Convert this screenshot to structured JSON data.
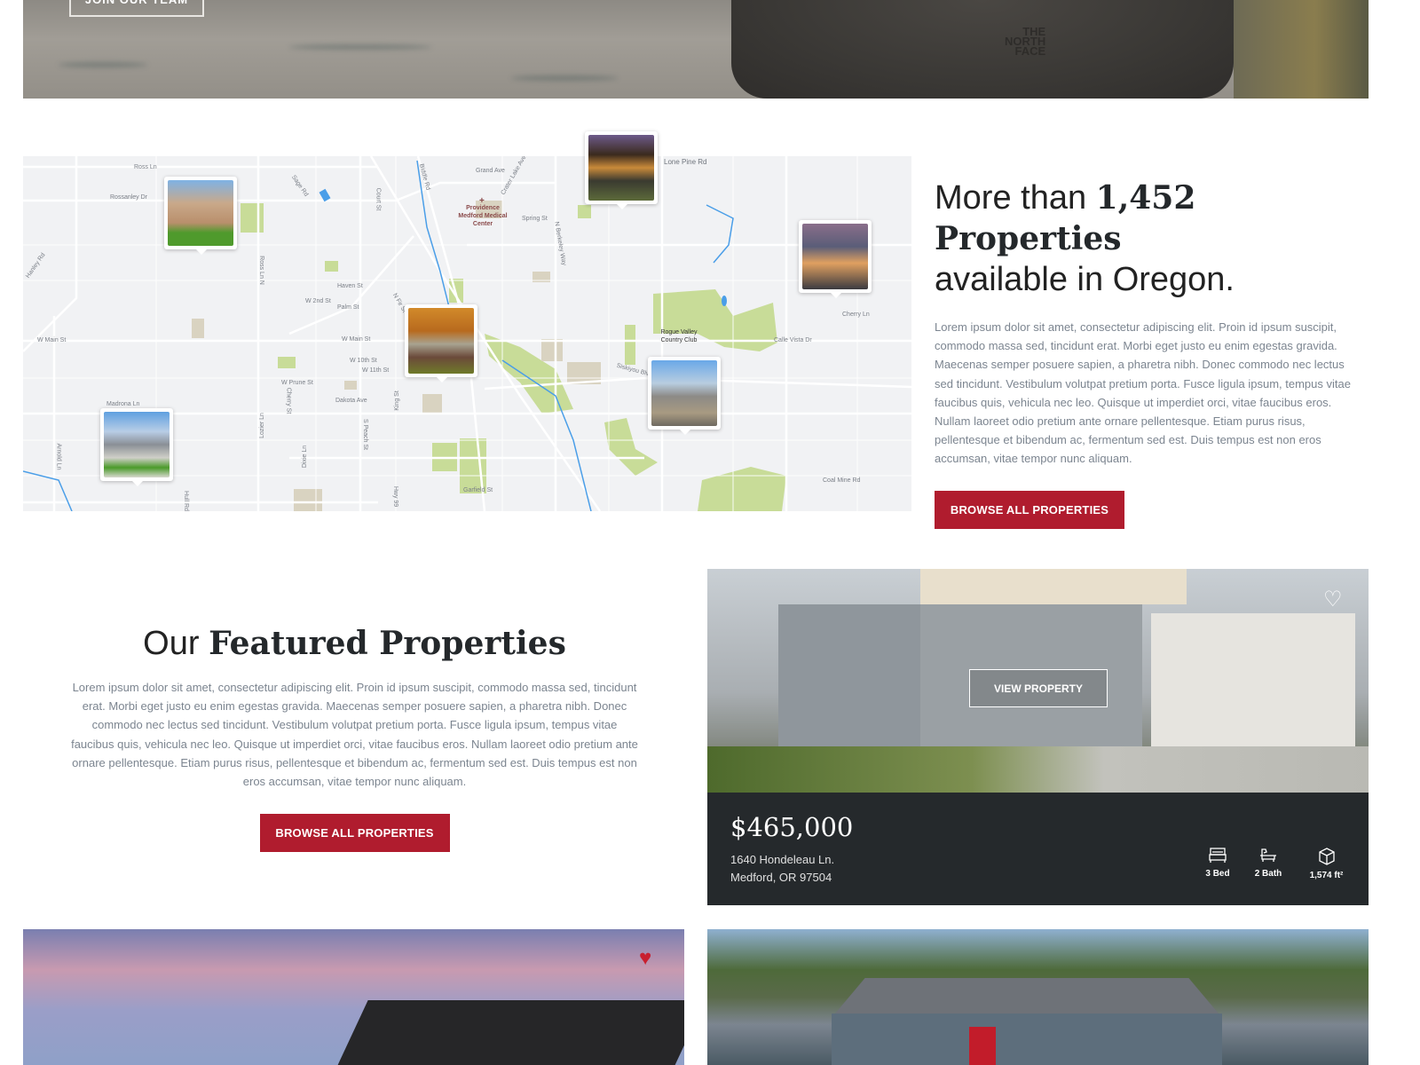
{
  "hero": {
    "join_button": "JOIN OUR TEAM",
    "shirt_logo": "THE NORTH FACE"
  },
  "map": {
    "labels": [
      "Ross Ln",
      "Rossanley Dr",
      "Hanley Rd",
      "Sage Rd",
      "Court St",
      "Biddle Rd",
      "Ross Ln N",
      "Haven St",
      "W 2nd St",
      "Palm St",
      "N Fir St",
      "W Main St",
      "W Main St",
      "W 10th St",
      "W 11th St",
      "W Prune St",
      "Cherry St",
      "Dakota Ave",
      "King St",
      "Madrona Ln",
      "Lozier Ln",
      "S Peach St",
      "Dixie Ln",
      "Arnold Ln",
      "Hull Rd",
      "Hwy 99",
      "Grand Ave",
      "Crater Lake Ave",
      "Providence Medford Medical Center",
      "Spring St",
      "N Berkeley Way",
      "Lone Pine Rd",
      "Rogue Valley Country Club",
      "Siskiyou Blvd",
      "Cherry Ln",
      "Calle Vista Dr",
      "Coal Mine Rd",
      "Garfield St"
    ],
    "colors": {
      "land": "#f1f2f4",
      "road": "#ffffff",
      "park": "#c8dc98",
      "urban": "#d9d3c1",
      "water": "#4a9ee8"
    }
  },
  "intro": {
    "heading_light": "More than ",
    "heading_bold": "1,452 Properties",
    "heading_rest": "available in Oregon.",
    "body": "Lorem ipsum dolor sit amet, consectetur adipiscing elit. Proin id ipsum suscipit, commodo massa sed, tincidunt erat. Morbi eget justo eu enim egestas gravida. Maecenas semper posuere sapien, a pharetra nibh. Donec commodo nec lectus sed tincidunt. Vestibulum volutpat pretium porta. Fusce ligula ipsum, tempus vitae faucibus quis, vehicula nec leo. Quisque ut imperdiet orci, vitae faucibus eros. Nullam laoreet odio pretium ante ornare pellentesque. Etiam purus risus, pellentesque et bibendum ac, fermentum sed est. Duis tempus est non eros accumsan, vitae tempor nunc aliquam.",
    "button": "BROWSE ALL PROPERTIES"
  },
  "featured": {
    "heading_light": "Our ",
    "heading_bold": "Featured Properties",
    "body": "Lorem ipsum dolor sit amet, consectetur adipiscing elit. Proin id ipsum suscipit, commodo massa sed, tincidunt erat. Morbi eget justo eu enim egestas gravida. Maecenas semper posuere sapien, a pharetra nibh. Donec commodo nec lectus sed tincidunt. Vestibulum volutpat pretium porta. Fusce ligula ipsum, tempus vitae faucibus quis, vehicula nec leo. Quisque ut imperdiet orci, vitae faucibus eros. Nullam laoreet odio pretium ante ornare pellentesque. Etiam purus risus, pellentesque et bibendum ac, fermentum sed est. Duis tempus est non eros accumsan, vitae tempor nunc aliquam.",
    "button": "BROWSE ALL PROPERTIES"
  },
  "property": {
    "view_button": "VIEW PROPERTY",
    "price": "$465,000",
    "address_line1": "1640 Hondeleau Ln.",
    "address_line2": "Medford, OR 97504",
    "beds": "3 Bed",
    "baths": "2 Bath",
    "area": "1,574 ft²",
    "favorited": false
  },
  "cards": [
    {
      "favorited": true
    },
    {
      "favorited": false
    }
  ],
  "colors": {
    "accent": "#b01c2e",
    "panel": "#25292c",
    "heart_active": "#c8202f"
  }
}
